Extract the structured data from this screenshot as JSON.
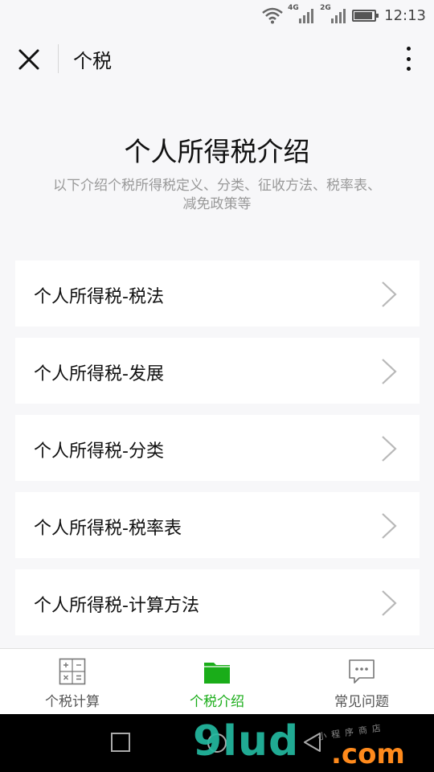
{
  "status_bar": {
    "network_1": "4G",
    "network_2": "2G",
    "battery_level": 0.9,
    "time": "12:13",
    "icons": [
      "wifi-icon",
      "signal-4g-icon",
      "signal-2g-icon",
      "battery-icon"
    ]
  },
  "nav": {
    "title": "个税",
    "close_icon": "close-icon",
    "more_icon": "more-vertical-icon"
  },
  "hero": {
    "title": "个人所得税介绍",
    "subtitle": "以下介绍个税所得税定义、分类、征收方法、税率表、减免政策等"
  },
  "list": {
    "items": [
      {
        "label": "个人所得税-税法"
      },
      {
        "label": "个人所得税-发展"
      },
      {
        "label": "个人所得税-分类"
      },
      {
        "label": "个人所得税-税率表"
      },
      {
        "label": "个人所得税-计算方法"
      }
    ]
  },
  "tabbar": {
    "tabs": [
      {
        "label": "个税计算",
        "icon": "calculator-icon",
        "active": false
      },
      {
        "label": "个税介绍",
        "icon": "folder-icon",
        "active": true
      },
      {
        "label": "常见问题",
        "icon": "chat-bubble-icon",
        "active": false
      }
    ]
  },
  "system_nav": {
    "icons": [
      "recents-icon",
      "home-icon",
      "back-icon"
    ]
  },
  "watermark": {
    "main": "9lud",
    "suffix": ".com",
    "cn": "小程序商店"
  },
  "colors": {
    "accent": "#1aad19",
    "background": "#f7f7f9",
    "text_secondary": "#999999"
  }
}
